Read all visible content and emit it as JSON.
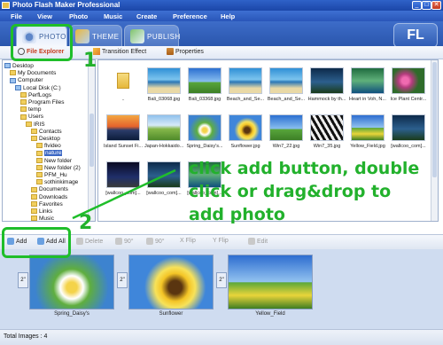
{
  "window": {
    "title": "Photo Flash Maker Professional",
    "buttons": [
      "_",
      "□",
      "✕"
    ]
  },
  "menu": [
    "File",
    "View",
    "Photo",
    "Music",
    "Create",
    "Preference",
    "Help"
  ],
  "tabs": [
    {
      "label": "PHOTO",
      "active": true
    },
    {
      "label": "THEME",
      "active": false
    },
    {
      "label": "PUBLISH",
      "active": false
    }
  ],
  "logo": "FL",
  "subtoolbar": {
    "file_explorer": "File Explorer",
    "transition_effect": "Transition Effect",
    "properties": "Properties"
  },
  "tree": [
    {
      "label": "Desktop",
      "indent": 0,
      "type": "pc"
    },
    {
      "label": "My Documents",
      "indent": 1,
      "type": "folder"
    },
    {
      "label": "Computer",
      "indent": 1,
      "type": "pc"
    },
    {
      "label": "Local Disk (C:)",
      "indent": 2,
      "type": "pc"
    },
    {
      "label": "PerfLogs",
      "indent": 3,
      "type": "folder"
    },
    {
      "label": "Program Files",
      "indent": 3,
      "type": "folder"
    },
    {
      "label": "temp",
      "indent": 3,
      "type": "folder"
    },
    {
      "label": "Users",
      "indent": 3,
      "type": "folder"
    },
    {
      "label": "IRIS",
      "indent": 4,
      "type": "folder"
    },
    {
      "label": "Contacts",
      "indent": 5,
      "type": "folder"
    },
    {
      "label": "Desktop",
      "indent": 5,
      "type": "folder"
    },
    {
      "label": "flvideo",
      "indent": 6,
      "type": "folder"
    },
    {
      "label": "nature",
      "indent": 6,
      "type": "folder",
      "selected": true
    },
    {
      "label": "New folder",
      "indent": 6,
      "type": "folder"
    },
    {
      "label": "New folder (2)",
      "indent": 6,
      "type": "folder"
    },
    {
      "label": "PFM_Hu",
      "indent": 6,
      "type": "folder"
    },
    {
      "label": "sothinkimage",
      "indent": 6,
      "type": "folder"
    },
    {
      "label": "Documents",
      "indent": 5,
      "type": "folder"
    },
    {
      "label": "Downloads",
      "indent": 5,
      "type": "folder"
    },
    {
      "label": "Favorites",
      "indent": 5,
      "type": "folder"
    },
    {
      "label": "Links",
      "indent": 5,
      "type": "folder"
    },
    {
      "label": "Music",
      "indent": 5,
      "type": "folder"
    }
  ],
  "grid": [
    {
      "caption": "..",
      "kind": "folder"
    },
    {
      "caption": "Bali_03068.jpg",
      "kind": "sea"
    },
    {
      "caption": "Bali_03368.jpg",
      "kind": "sky"
    },
    {
      "caption": "Beach_and_Se...",
      "kind": "sea"
    },
    {
      "caption": "Beach_and_Se...",
      "kind": "sea"
    },
    {
      "caption": "Hammock by th...",
      "kind": "dark"
    },
    {
      "caption": "Heart in Voh, N...",
      "kind": "green"
    },
    {
      "caption": "Ice Plant Centr...",
      "kind": "flower"
    },
    {
      "caption": "Island Sunset Fi...",
      "kind": "sunset"
    },
    {
      "caption": "Japan-Hokkaido...",
      "kind": "grass"
    },
    {
      "caption": "Spring_Daisy's...",
      "kind": "daisy"
    },
    {
      "caption": "Sunflower.jpg",
      "kind": "sunflower"
    },
    {
      "caption": "Win7_22.jpg",
      "kind": "sky"
    },
    {
      "caption": "Win7_35.jpg",
      "kind": "zebra"
    },
    {
      "caption": "Yellow_Field.jpg",
      "kind": "field"
    },
    {
      "caption": "[wallcoo_com]...",
      "kind": "dark"
    },
    {
      "caption": "[wallcoo_com]...",
      "kind": "night"
    },
    {
      "caption": "[wallcoo_com]...",
      "kind": "dark"
    },
    {
      "caption": "[wallcoo_com]...",
      "kind": "green"
    }
  ],
  "actions": [
    {
      "label": "Add",
      "enabled": true
    },
    {
      "label": "Add All",
      "enabled": true
    },
    {
      "label": "Delete",
      "enabled": false
    },
    {
      "label": "90°",
      "enabled": false
    },
    {
      "label": "90°",
      "enabled": false
    },
    {
      "label": "X Flip",
      "enabled": false
    },
    {
      "label": "Y Flip",
      "enabled": false
    },
    {
      "label": "Edit",
      "enabled": false
    }
  ],
  "filmstrip": [
    {
      "caption": "Spring_Daisy's",
      "duration": "2\"",
      "kind": "daisy"
    },
    {
      "caption": "Sunflower",
      "duration": "2\"",
      "kind": "sunflower"
    },
    {
      "caption": "Yellow_Field",
      "duration": "2\"",
      "kind": "field"
    }
  ],
  "status": "Total Images : 4",
  "annotations": {
    "step1": "1",
    "step2": "2",
    "instruction_lines": [
      "click add button, double",
      "click or drag&drop to",
      "add photo"
    ]
  },
  "colors": {
    "annotation_green": "#22b12c",
    "titlebar_blue": "#2f62c8",
    "selection_blue": "#3b67c4"
  }
}
